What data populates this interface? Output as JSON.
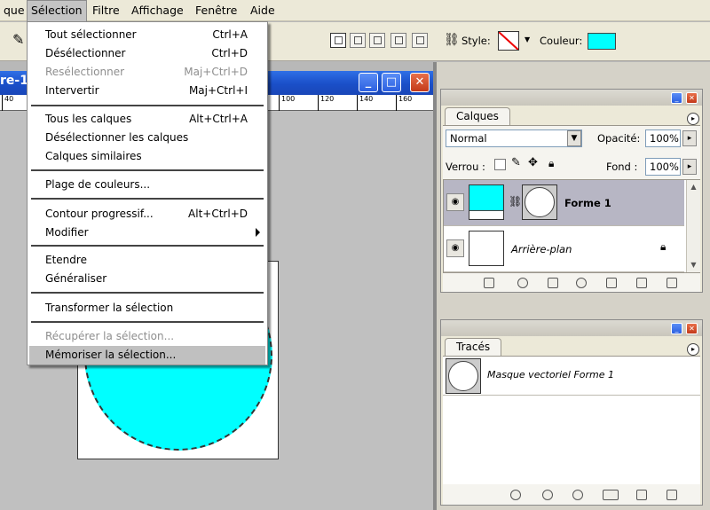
{
  "menubar": {
    "items": [
      "que",
      "Sélection",
      "Filtre",
      "Affichage",
      "Fenêtre",
      "Aide"
    ],
    "active_index": 1
  },
  "options_bar": {
    "style_label": "Style:",
    "color_label": "Couleur:",
    "color_swatch": "#00ffff"
  },
  "document": {
    "title": "re-1",
    "ruler_ticks": [
      "40",
      "100",
      "120",
      "140",
      "160"
    ],
    "shape_color": "#00ffff"
  },
  "selection_menu": {
    "items": [
      {
        "label": "Tout sélectionner",
        "shortcut": "Ctrl+A",
        "disabled": false
      },
      {
        "label": "Désélectionner",
        "shortcut": "Ctrl+D",
        "disabled": false
      },
      {
        "label": "Resélectionner",
        "shortcut": "Maj+Ctrl+D",
        "disabled": true
      },
      {
        "label": "Intervertir",
        "shortcut": "Maj+Ctrl+I",
        "disabled": false
      },
      {
        "label": "Tous les calques",
        "shortcut": "Alt+Ctrl+A",
        "disabled": false
      },
      {
        "label": "Désélectionner les calques",
        "shortcut": "",
        "disabled": false
      },
      {
        "label": "Calques similaires",
        "shortcut": "",
        "disabled": false
      },
      {
        "label": "Plage de couleurs...",
        "shortcut": "",
        "disabled": false
      },
      {
        "label": "Contour progressif...",
        "shortcut": "Alt+Ctrl+D",
        "disabled": false
      },
      {
        "label": "Modifier",
        "shortcut": "",
        "disabled": false,
        "submenu": true
      },
      {
        "label": "Etendre",
        "shortcut": "",
        "disabled": false
      },
      {
        "label": "Généraliser",
        "shortcut": "",
        "disabled": false
      },
      {
        "label": "Transformer la sélection",
        "shortcut": "",
        "disabled": false
      },
      {
        "label": "Récupérer la sélection...",
        "shortcut": "",
        "disabled": true
      },
      {
        "label": "Mémoriser la sélection...",
        "shortcut": "",
        "disabled": false,
        "highlighted": true
      }
    ]
  },
  "layers_panel": {
    "tab": "Calques",
    "blend_mode": "Normal",
    "opacity_label": "Opacité:",
    "opacity_value": "100%",
    "lock_label": "Verrou :",
    "fill_label": "Fond :",
    "fill_value": "100%",
    "layers": [
      {
        "name": "Forme 1",
        "selected": true
      },
      {
        "name": "Arrière-plan",
        "selected": false,
        "locked": true
      }
    ]
  },
  "paths_panel": {
    "tab": "Tracés",
    "paths": [
      {
        "name": "Masque vectoriel Forme 1"
      }
    ]
  }
}
